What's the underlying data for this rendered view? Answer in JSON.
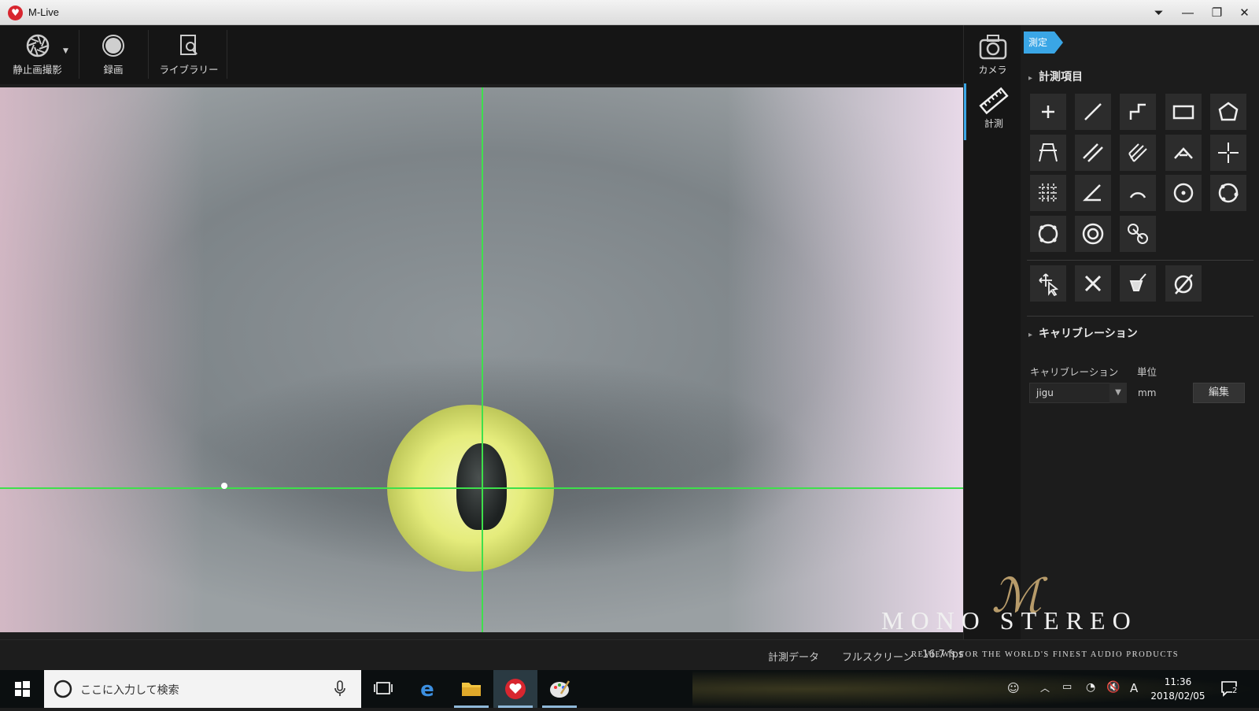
{
  "window": {
    "title": "M-Live",
    "logo_icon": "m-live-heart-logo",
    "controls": [
      "menu-down-icon",
      "minimize-icon",
      "restore-icon",
      "close-icon"
    ]
  },
  "toolbar": {
    "still_capture_label": "静止画撮影",
    "record_label": "録画",
    "library_label": "ライブラリー"
  },
  "sidebar": {
    "camera_label": "カメラ",
    "measure_label": "計測"
  },
  "panel": {
    "tag_label": "測定",
    "section_items_title": "計測項目",
    "tools": [
      "point-icon",
      "line-icon",
      "polyline-icon",
      "rectangle-icon",
      "polygon-icon",
      "triangle-angle-icon",
      "parallel-lines-icon",
      "multi-lines-icon",
      "angle-vertex-icon",
      "crosshair-icon",
      "grid-points-icon",
      "angle-icon",
      "arc-icon",
      "circle-center-icon",
      "circle-3point-icon",
      "circle-4point-icon",
      "concentric-circle-icon",
      "circle-distance-icon"
    ],
    "edit_tools": [
      "select-move-icon",
      "delete-icon",
      "clear-icon",
      "hide-icon"
    ],
    "section_calib_title": "キャリブレーション",
    "calib_label": "キャリブレーション",
    "unit_label": "単位",
    "calib_value": "jigu",
    "unit_value": "mm",
    "edit_button": "編集"
  },
  "statusbar": {
    "measure_data": "計測データ",
    "fullscreen": "フルスクリーン",
    "fps": "16.7 fps"
  },
  "watermark": {
    "brand": "MONO STEREO",
    "tagline": "REVIEWS FOR THE WORLD'S FINEST AUDIO PRODUCTS"
  },
  "taskbar": {
    "search_placeholder": "ここに入力して検索",
    "time": "11:36",
    "date": "2018/02/05",
    "ime": "A",
    "notification_count": "2"
  },
  "colors": {
    "crosshair": "#3ee04b",
    "tag": "#3aa6e6"
  }
}
